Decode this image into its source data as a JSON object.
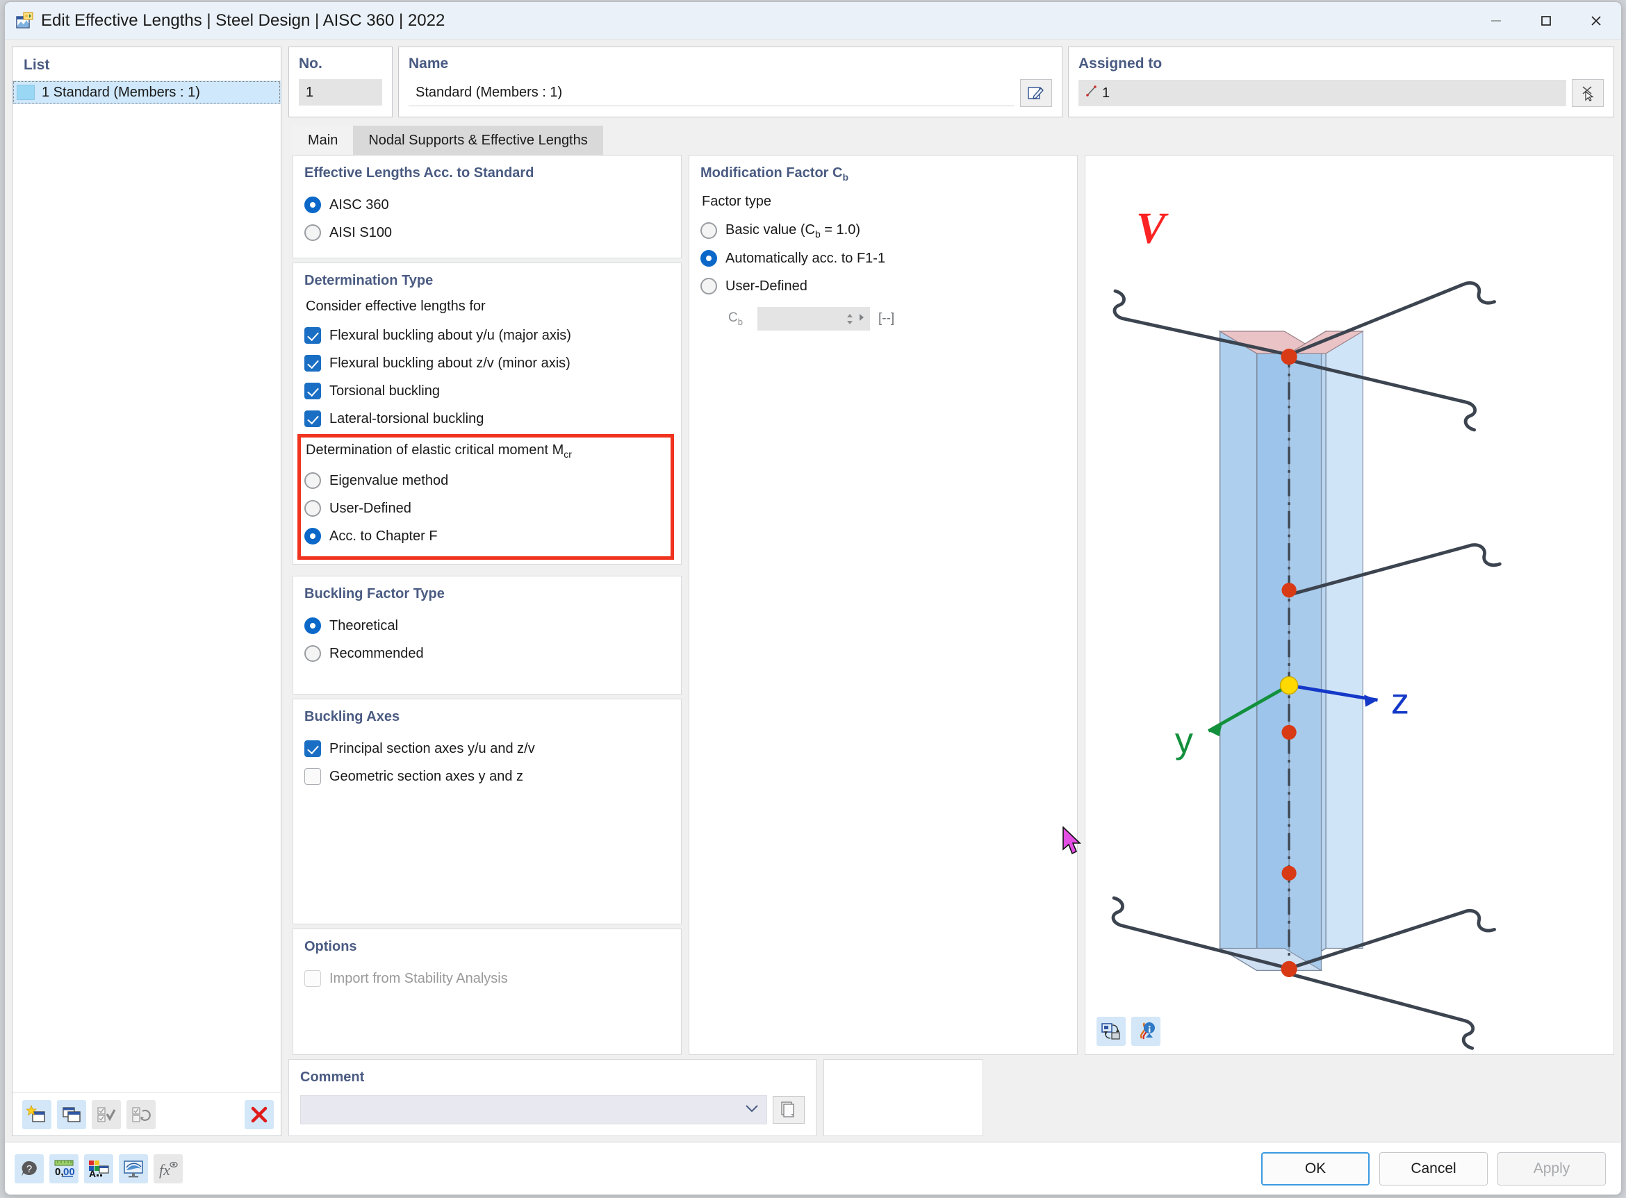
{
  "window": {
    "title": "Edit Effective Lengths | Steel Design | AISC 360 | 2022",
    "minimize": "—",
    "maximize": "□",
    "close": "✕"
  },
  "list_panel": {
    "title": "List",
    "rows": [
      {
        "label": "1 Standard (Members : 1)",
        "selected": true
      }
    ],
    "toolbar": [
      {
        "name": "new-item-button",
        "enabled": true
      },
      {
        "name": "duplicate-item-button",
        "enabled": true
      },
      {
        "name": "select-all-button",
        "enabled": false
      },
      {
        "name": "invert-selection-button",
        "enabled": false
      },
      {
        "name": "delete-item-button",
        "enabled": true
      }
    ]
  },
  "fields": {
    "no_label": "No.",
    "no_value": "1",
    "name_label": "Name",
    "name_value": "Standard (Members : 1)",
    "assigned_label": "Assigned to",
    "assigned_value": "1"
  },
  "tabs": [
    {
      "label": "Main",
      "active": true
    },
    {
      "label": "Nodal Supports & Effective Lengths",
      "active": false
    }
  ],
  "standard": {
    "title": "Effective Lengths Acc. to Standard",
    "options": [
      {
        "label": "AISC 360",
        "selected": true
      },
      {
        "label": "AISI S100",
        "selected": false
      }
    ]
  },
  "determination": {
    "title": "Determination Type",
    "consider_label": "Consider effective lengths for",
    "checks": [
      {
        "label": "Flexural buckling about y/u (major axis)",
        "checked": true
      },
      {
        "label": "Flexural buckling about z/v (minor axis)",
        "checked": true
      },
      {
        "label": "Torsional buckling",
        "checked": true
      },
      {
        "label": "Lateral-torsional buckling",
        "checked": true
      }
    ],
    "mcr_label": "Determination of elastic critical moment Mcr",
    "mcr_label_main": "Determination of elastic critical moment M",
    "mcr_label_sub": "cr",
    "mcr_options": [
      {
        "label": "Eigenvalue method",
        "selected": false
      },
      {
        "label": "User-Defined",
        "selected": false
      },
      {
        "label": "Acc. to Chapter F",
        "selected": true
      }
    ],
    "highlight_color": "#f0331f"
  },
  "buckling_factor": {
    "title": "Buckling Factor Type",
    "options": [
      {
        "label": "Theoretical",
        "selected": true
      },
      {
        "label": "Recommended",
        "selected": false
      }
    ]
  },
  "buckling_axes": {
    "title": "Buckling Axes",
    "checks": [
      {
        "label": "Principal section axes y/u and z/v",
        "checked": true
      },
      {
        "label": "Geometric section axes y and z",
        "checked": false
      }
    ]
  },
  "options": {
    "title": "Options",
    "checks": [
      {
        "label": "Import from Stability Analysis",
        "checked": false,
        "enabled": false
      }
    ]
  },
  "modification_factor": {
    "title_main": "Modification Factor C",
    "title_sub": "b",
    "factor_type_label": "Factor type",
    "options": [
      {
        "label_main": "Basic value (C",
        "label_sub": "b",
        "label_tail": " = 1.0)",
        "selected": false
      },
      {
        "label_main": "Automatically acc. to F1-1",
        "label_sub": "",
        "label_tail": "",
        "selected": true
      },
      {
        "label_main": "User-Defined",
        "label_sub": "",
        "label_tail": "",
        "selected": false
      }
    ],
    "cb_field_label_main": "C",
    "cb_field_label_sub": "b",
    "cb_value": "",
    "cb_unit": "[--]",
    "cb_enabled": false
  },
  "comment": {
    "title": "Comment",
    "value": "",
    "dropdown_icon": "chevron-down-icon"
  },
  "viewport": {
    "axis_y_label": "y",
    "axis_z_label": "z",
    "annotation_label": "V",
    "axis_y_color": "#12903c",
    "axis_z_color": "#1438c8",
    "annotation_color": "#fb2323",
    "node_color": "#d83a16",
    "origin_node_color": "#ffd900",
    "member_color": "#9dc4ea",
    "tools": [
      {
        "name": "toggle-view-button"
      },
      {
        "name": "model-info-button"
      }
    ]
  },
  "footer": {
    "tools": [
      {
        "name": "help-button",
        "enabled": true
      },
      {
        "name": "decimal-places-button",
        "enabled": true
      },
      {
        "name": "display-properties-button",
        "enabled": true
      },
      {
        "name": "rendering-button",
        "enabled": true
      },
      {
        "name": "formula-button",
        "enabled": false
      }
    ],
    "buttons": [
      {
        "label": "OK",
        "enabled": true,
        "primary": true
      },
      {
        "label": "Cancel",
        "enabled": true,
        "primary": false
      },
      {
        "label": "Apply",
        "enabled": false,
        "primary": false
      }
    ]
  }
}
